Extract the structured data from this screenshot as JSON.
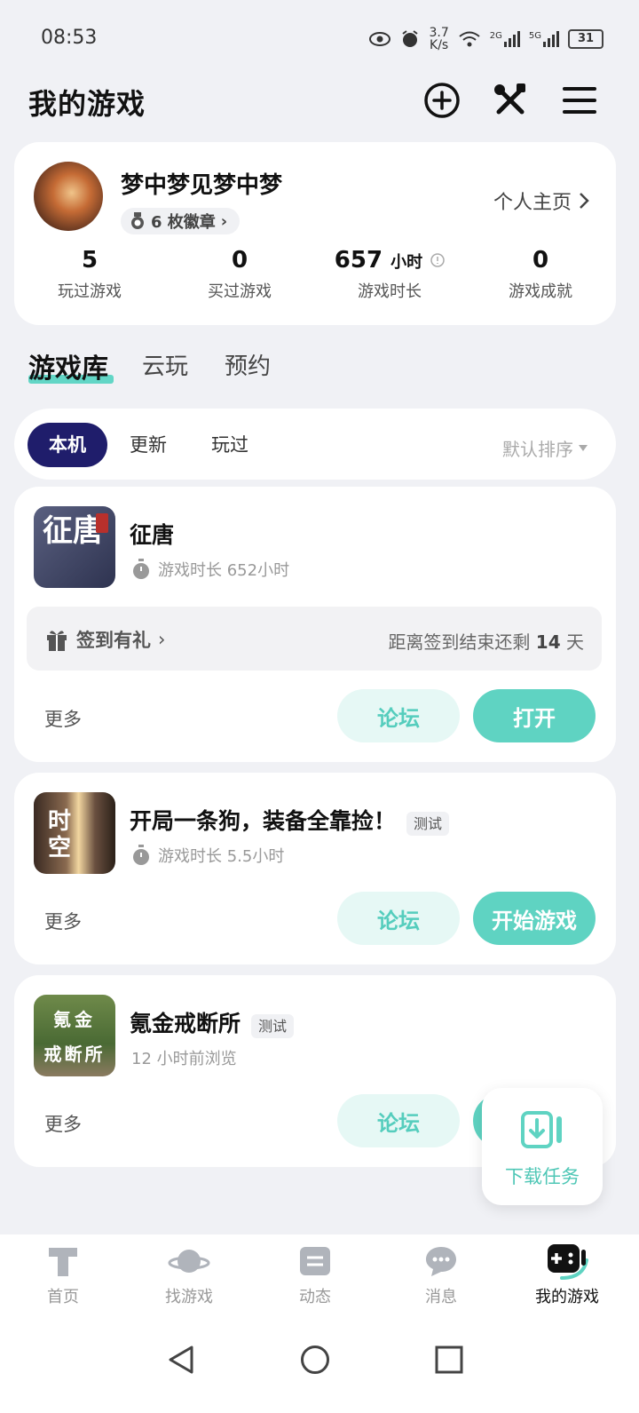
{
  "status_bar": {
    "time": "08:53",
    "net_speed_top": "3.7",
    "net_speed_bottom": "K/s",
    "battery": "31",
    "sig1": "2G",
    "sig2": "5G"
  },
  "header": {
    "title": "我的游戏"
  },
  "profile": {
    "username": "梦中梦见梦中梦",
    "badge_text": "6 枚徽章",
    "homepage_link": "个人主页",
    "stats": [
      {
        "value": "5",
        "unit": "",
        "label": "玩过游戏"
      },
      {
        "value": "0",
        "unit": "",
        "label": "买过游戏"
      },
      {
        "value": "657",
        "unit": "小时",
        "label": "游戏时长"
      },
      {
        "value": "0",
        "unit": "",
        "label": "游戏成就"
      }
    ]
  },
  "library_tabs": [
    "游戏库",
    "云玩",
    "预约"
  ],
  "filters": {
    "chips": [
      "本机",
      "更新",
      "玩过"
    ],
    "sort": "默认排序"
  },
  "games": [
    {
      "name": "征唐",
      "icon_text": "征唐",
      "tag": "",
      "subtitle": "游戏时长 652小时",
      "signin": {
        "label": "签到有礼",
        "prefix": "距离签到结束还剩",
        "days": "14",
        "suffix": "天"
      },
      "more": "更多",
      "forum": "论坛",
      "action": "打开"
    },
    {
      "name": "开局一条狗，装备全靠捡！",
      "icon_text": "时空",
      "tag": "测试",
      "subtitle": "游戏时长 5.5小时",
      "more": "更多",
      "forum": "论坛",
      "action": "开始游戏"
    },
    {
      "name": "氪金戒断所",
      "icon_text_1": "氪金",
      "icon_text_2": "戒断所",
      "tag": "测试",
      "subtitle": "12 小时前浏览",
      "more": "更多",
      "forum": "论坛"
    }
  ],
  "download_float": {
    "label": "下载任务"
  },
  "bottom_nav": [
    {
      "label": "首页",
      "icon": "home-icon"
    },
    {
      "label": "找游戏",
      "icon": "planet-icon"
    },
    {
      "label": "动态",
      "icon": "feed-icon"
    },
    {
      "label": "消息",
      "icon": "chat-icon"
    },
    {
      "label": "我的游戏",
      "icon": "gamepad-icon"
    }
  ],
  "colors": {
    "accent": "#5fd3c2",
    "chip_active": "#1f1d6b",
    "background": "#f0f1f5"
  }
}
